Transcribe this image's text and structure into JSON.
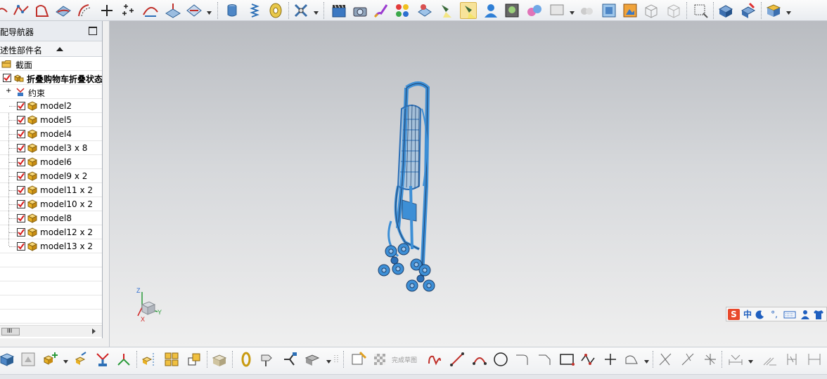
{
  "navigator": {
    "title": "配导航器",
    "column_header": "述性部件名",
    "tree": [
      {
        "label": "截面",
        "icon": "folder-icon",
        "level": 0,
        "checked": null
      },
      {
        "label": "折叠购物车折叠状态",
        "icon": "assembly-icon",
        "level": 0,
        "checked": true,
        "bold": true
      },
      {
        "label": "约束",
        "icon": "constraints-icon",
        "level": 1,
        "checked": null
      },
      {
        "label": "model2",
        "icon": "part-icon",
        "level": 1,
        "checked": true
      },
      {
        "label": "model5",
        "icon": "part-icon",
        "level": 1,
        "checked": true
      },
      {
        "label": "model4",
        "icon": "part-icon",
        "level": 1,
        "checked": true
      },
      {
        "label": "model3 x 8",
        "icon": "part-icon",
        "level": 1,
        "checked": true
      },
      {
        "label": "model6",
        "icon": "part-icon",
        "level": 1,
        "checked": true
      },
      {
        "label": "model9 x 2",
        "icon": "part-icon",
        "level": 1,
        "checked": true
      },
      {
        "label": "model11 x 2",
        "icon": "part-icon",
        "level": 1,
        "checked": true
      },
      {
        "label": "model10 x 2",
        "icon": "part-icon",
        "level": 1,
        "checked": true
      },
      {
        "label": "model8",
        "icon": "part-icon",
        "level": 1,
        "checked": true
      },
      {
        "label": "model12 x 2",
        "icon": "part-icon",
        "level": 1,
        "checked": true
      },
      {
        "label": "model13 x 2",
        "icon": "part-icon",
        "level": 1,
        "checked": true
      }
    ],
    "scroll_thumb_label": "III"
  },
  "viewport": {
    "triad": {
      "z": "Z",
      "y": "Y",
      "x": "X"
    }
  },
  "ime_bar": {
    "logo": "S",
    "mode": "中",
    "items": [
      "moon-icon",
      "punctuation-icon",
      "keyboard-icon",
      "user-icon",
      "shirt-icon"
    ],
    "punctuation": "°,"
  },
  "bottom_toolbar": {
    "finish_sketch_label": "完成草图"
  },
  "colors": {
    "model_blue": "#3d8fd6",
    "check_red": "#d81e1e",
    "cube_gold": "#e8b024",
    "active_tool_bg": "#f7e39a"
  }
}
